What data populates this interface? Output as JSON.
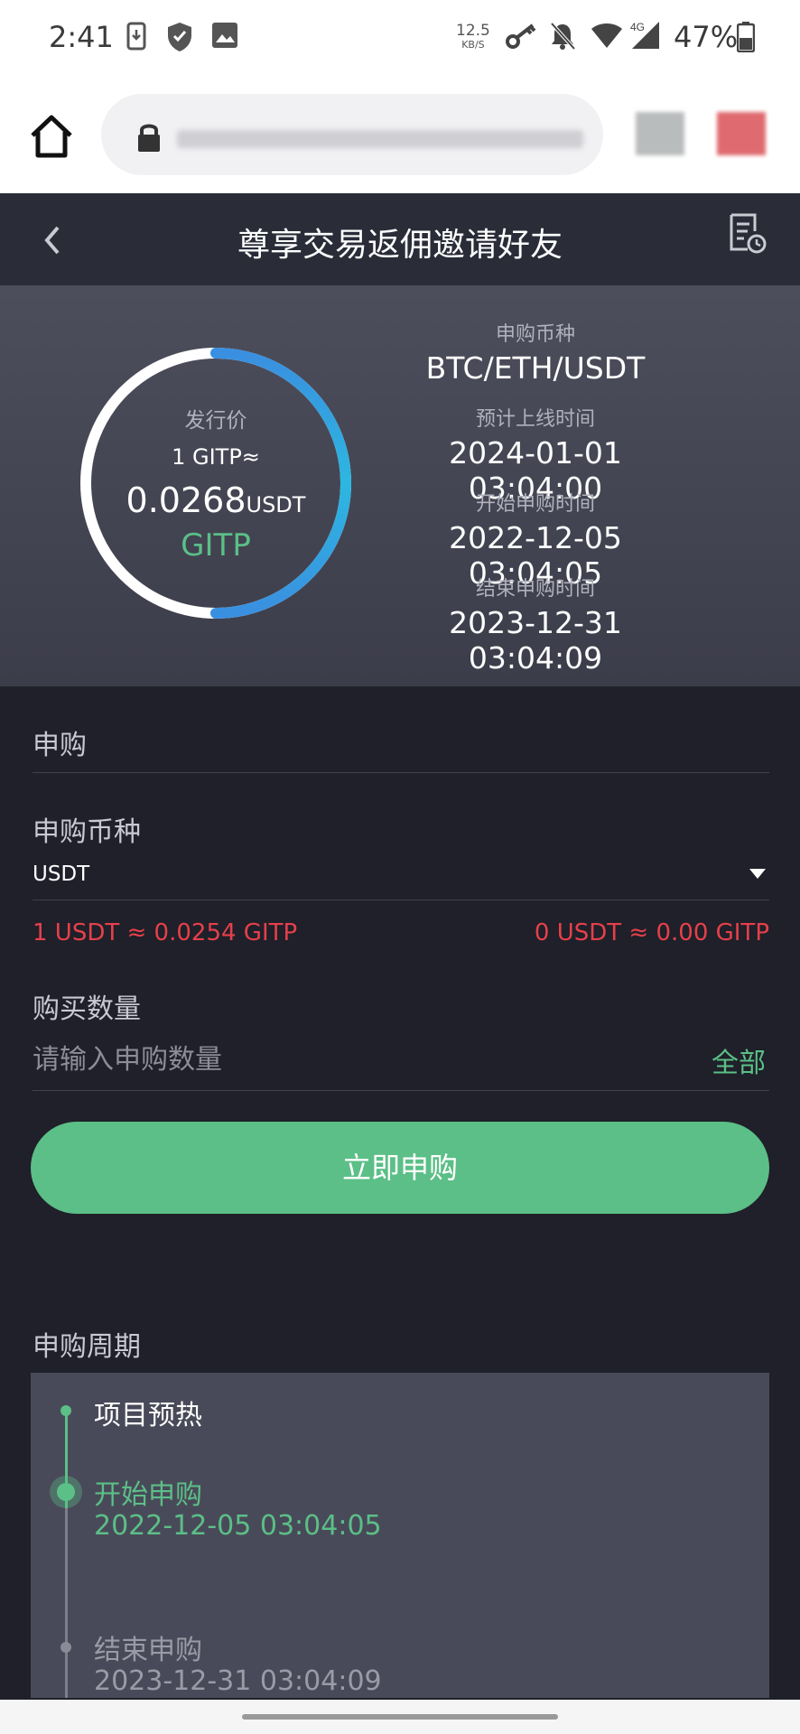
{
  "status_bar": {
    "time": "2:41",
    "net_speed": "12.5",
    "net_speed_unit": "KB/S",
    "network_type": "4G",
    "battery": "47%"
  },
  "browser": {
    "url_redacted": true
  },
  "header": {
    "title": "尊享交易返佣邀请好友"
  },
  "hero": {
    "ring_label": "发行价",
    "price_line1": "1 GITP≈",
    "price_value": "0.0268",
    "price_unit": "USDT",
    "token": "GITP",
    "info": [
      {
        "label": "申购币种",
        "value": "BTC/ETH/USDT"
      },
      {
        "label": "预计上线时间",
        "value": "2024-01-01 03:04:00"
      },
      {
        "label": "开始申购时间",
        "value": "2022-12-05 03:04:05"
      },
      {
        "label": "结束申购时间",
        "value": "2023-12-31 03:04:09"
      }
    ],
    "ring_progress": 0.5
  },
  "form": {
    "section_title": "申购",
    "currency_label": "申购币种",
    "currency_value": "USDT",
    "rate_left": "1 USDT ≈ 0.0254 GITP",
    "rate_right": "0 USDT ≈ 0.00 GITP",
    "quantity_label": "购买数量",
    "quantity_placeholder": "请输入申购数量",
    "all_label": "全部",
    "submit_label": "立即申购"
  },
  "timeline": {
    "title": "申购周期",
    "steps": [
      {
        "label": "项目预热",
        "date": ""
      },
      {
        "label": "开始申购",
        "date": "2022-12-05 03:04:05"
      },
      {
        "label": "结束申购",
        "date": "2023-12-31 03:04:09"
      }
    ]
  },
  "colors": {
    "accent_green": "#5bbf87",
    "rate_red": "#e5404b",
    "ring_blue": "#2cb7e0"
  }
}
